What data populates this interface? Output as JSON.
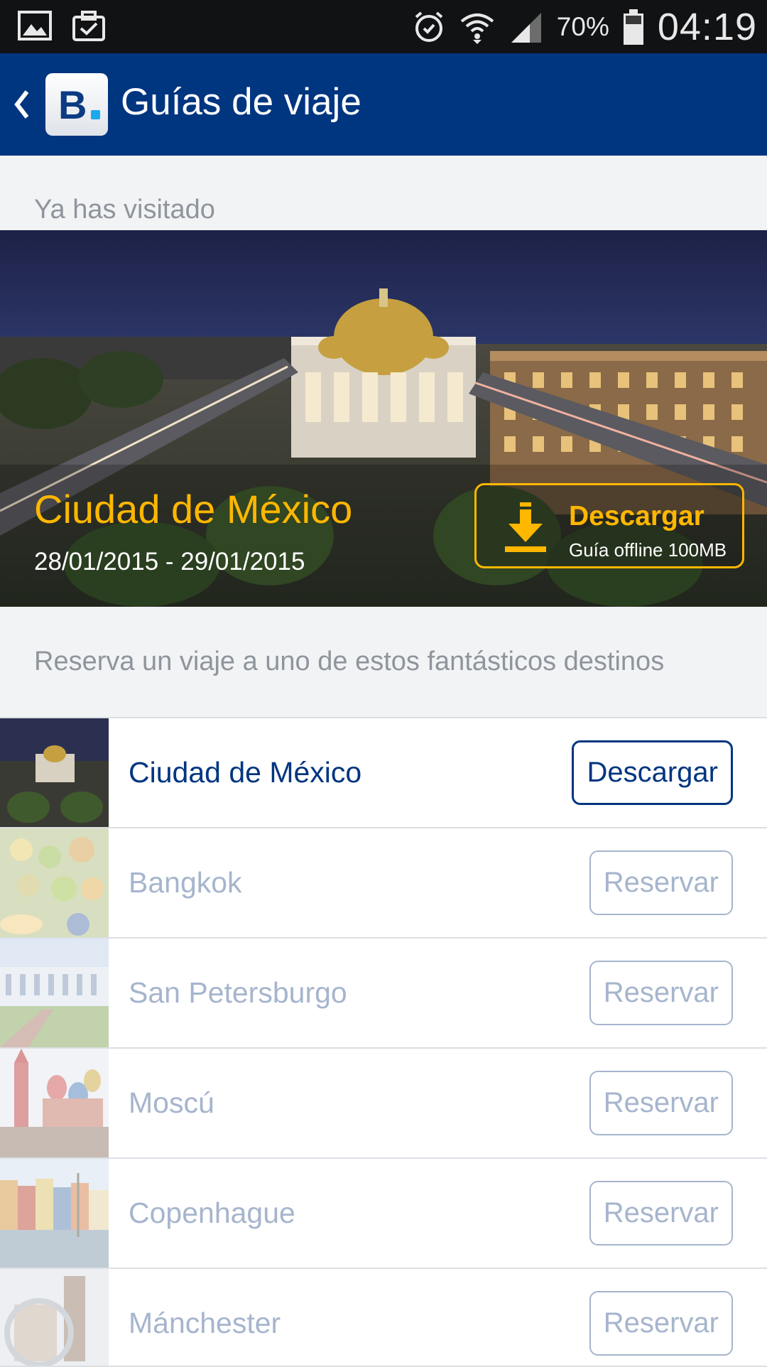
{
  "status_bar": {
    "battery": "70%",
    "time": "04:19",
    "icons": [
      "gallery-icon",
      "clipboard-check-icon",
      "alarm-icon",
      "wifi-icon",
      "signal-icon",
      "battery-icon"
    ]
  },
  "app_bar": {
    "title": "Guías de viaje",
    "logo_letter": "B",
    "back_icon": "chevron-left-icon"
  },
  "visited": {
    "header": "Ya has visitado",
    "city": "Ciudad de México",
    "dates": "28/01/2015 - 29/01/2015",
    "download": {
      "label": "Descargar",
      "subtitle": "Guía offline 100MB",
      "icon": "download-icon",
      "color": "#ffb700"
    }
  },
  "destinations": {
    "header": "Reserva un viaje a uno de estos fantásticos destinos",
    "items": [
      {
        "name": "Ciudad de México",
        "button": "Descargar"
      },
      {
        "name": "Bangkok",
        "button": "Reservar"
      },
      {
        "name": "San Petersburgo",
        "button": "Reservar"
      },
      {
        "name": "Moscú",
        "button": "Reservar"
      },
      {
        "name": "Copenhague",
        "button": "Reservar"
      },
      {
        "name": "Mánchester",
        "button": "Reservar"
      }
    ]
  },
  "colors": {
    "brand": "#003580",
    "accent": "#ffb700",
    "muted": "#a6b5cd"
  }
}
